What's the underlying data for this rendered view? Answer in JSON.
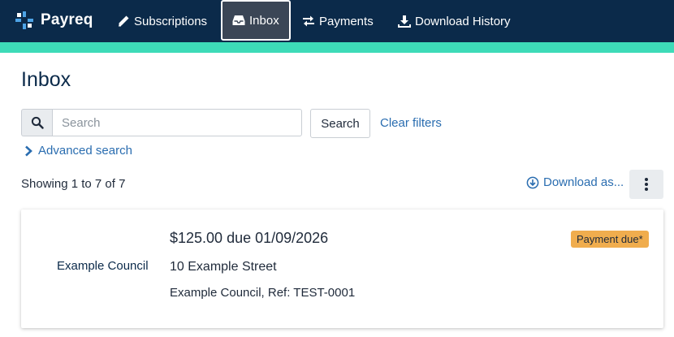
{
  "brand": {
    "name": "Payreq"
  },
  "nav": {
    "items": [
      {
        "label": "Subscriptions",
        "icon": "pencil-icon"
      },
      {
        "label": "Inbox",
        "icon": "inbox-icon",
        "active": true
      },
      {
        "label": "Payments",
        "icon": "transfer-arrows-icon"
      },
      {
        "label": "Download History",
        "icon": "download-icon"
      }
    ]
  },
  "page": {
    "title": "Inbox"
  },
  "search": {
    "placeholder": "Search",
    "value": "",
    "button_label": "Search",
    "clear_filters_label": "Clear filters",
    "advanced_label": "Advanced search"
  },
  "results": {
    "showing_text": "Showing 1 to 7 of 7",
    "download_label": "Download as..."
  },
  "items": [
    {
      "issuer": "Example Council",
      "amount_due": "$125.00 due 01/09/2026",
      "address": "10 Example Street",
      "reference": "Example Council, Ref: TEST-0001",
      "status": "Payment due*"
    }
  ],
  "colors": {
    "navbar": "#0b2a4a",
    "accent": "#3ddbb8",
    "link": "#2a6db0",
    "badge": "#f0ad4e"
  }
}
